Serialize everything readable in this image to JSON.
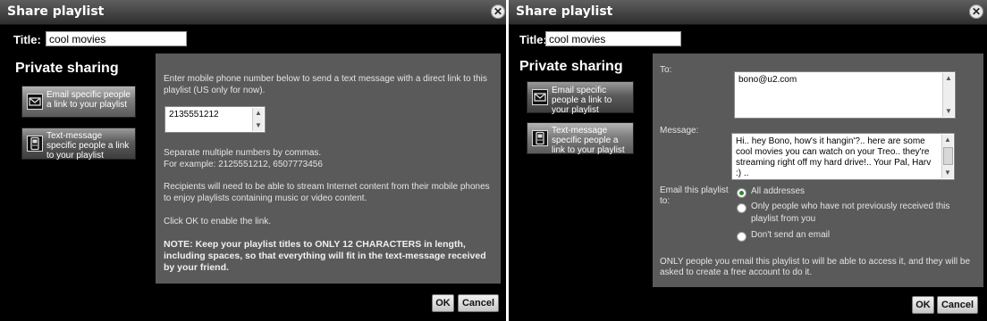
{
  "left_dialog": {
    "title": "Share playlist",
    "title_label": "Title:",
    "title_value": "cool movies",
    "private_sharing": "Private sharing",
    "option_email": "Email specific people a link to your playlist",
    "option_text": "Text-message specific people a link to your playlist",
    "intro": "Enter mobile phone number below to send a text message with a direct link to this playlist (US only for now).",
    "phone_value": "2135551212",
    "separate_line1": "Separate multiple numbers by commas.",
    "separate_line2": "For example: 2125551212, 6507773456",
    "recipients": "Recipients will need to be able to stream Internet content from their mobile phones to enjoy playlists containing music or video content.",
    "click_ok": "Click OK to enable the link.",
    "note": "NOTE: Keep your playlist titles to ONLY 12 CHARACTERS in length, including spaces, so that everything will fit in the text-message received by your friend.",
    "ok": "OK",
    "cancel": "Cancel"
  },
  "right_dialog": {
    "title": "Share playlist",
    "title_label": "Title:",
    "title_value": "cool movies",
    "private_sharing": "Private sharing",
    "option_email": "Email specific people a link to your playlist",
    "option_text": "Text-message specific people a link to your playlist",
    "to_label": "To:",
    "to_value": "bono@u2.com",
    "message_label": "Message:",
    "message_value": "Hi.. hey Bono, how's it hangin'?.. here are some cool movies you can watch on your Treo.. they're streaming right off my hard drive!.. Your Pal, Harv :) ..",
    "email_label": "Email this playlist to:",
    "radio_all": "All addresses",
    "radio_only": "Only people who have not previously received this playlist from you",
    "radio_dont": "Don't send an email",
    "footer": "ONLY people you email this playlist to will be able to access it, and they will be asked to create a free account to do it.",
    "ok": "OK",
    "cancel": "Cancel"
  },
  "icons": {
    "close": "close-icon",
    "email": "envelope-icon",
    "phone": "mobile-phone-icon"
  }
}
